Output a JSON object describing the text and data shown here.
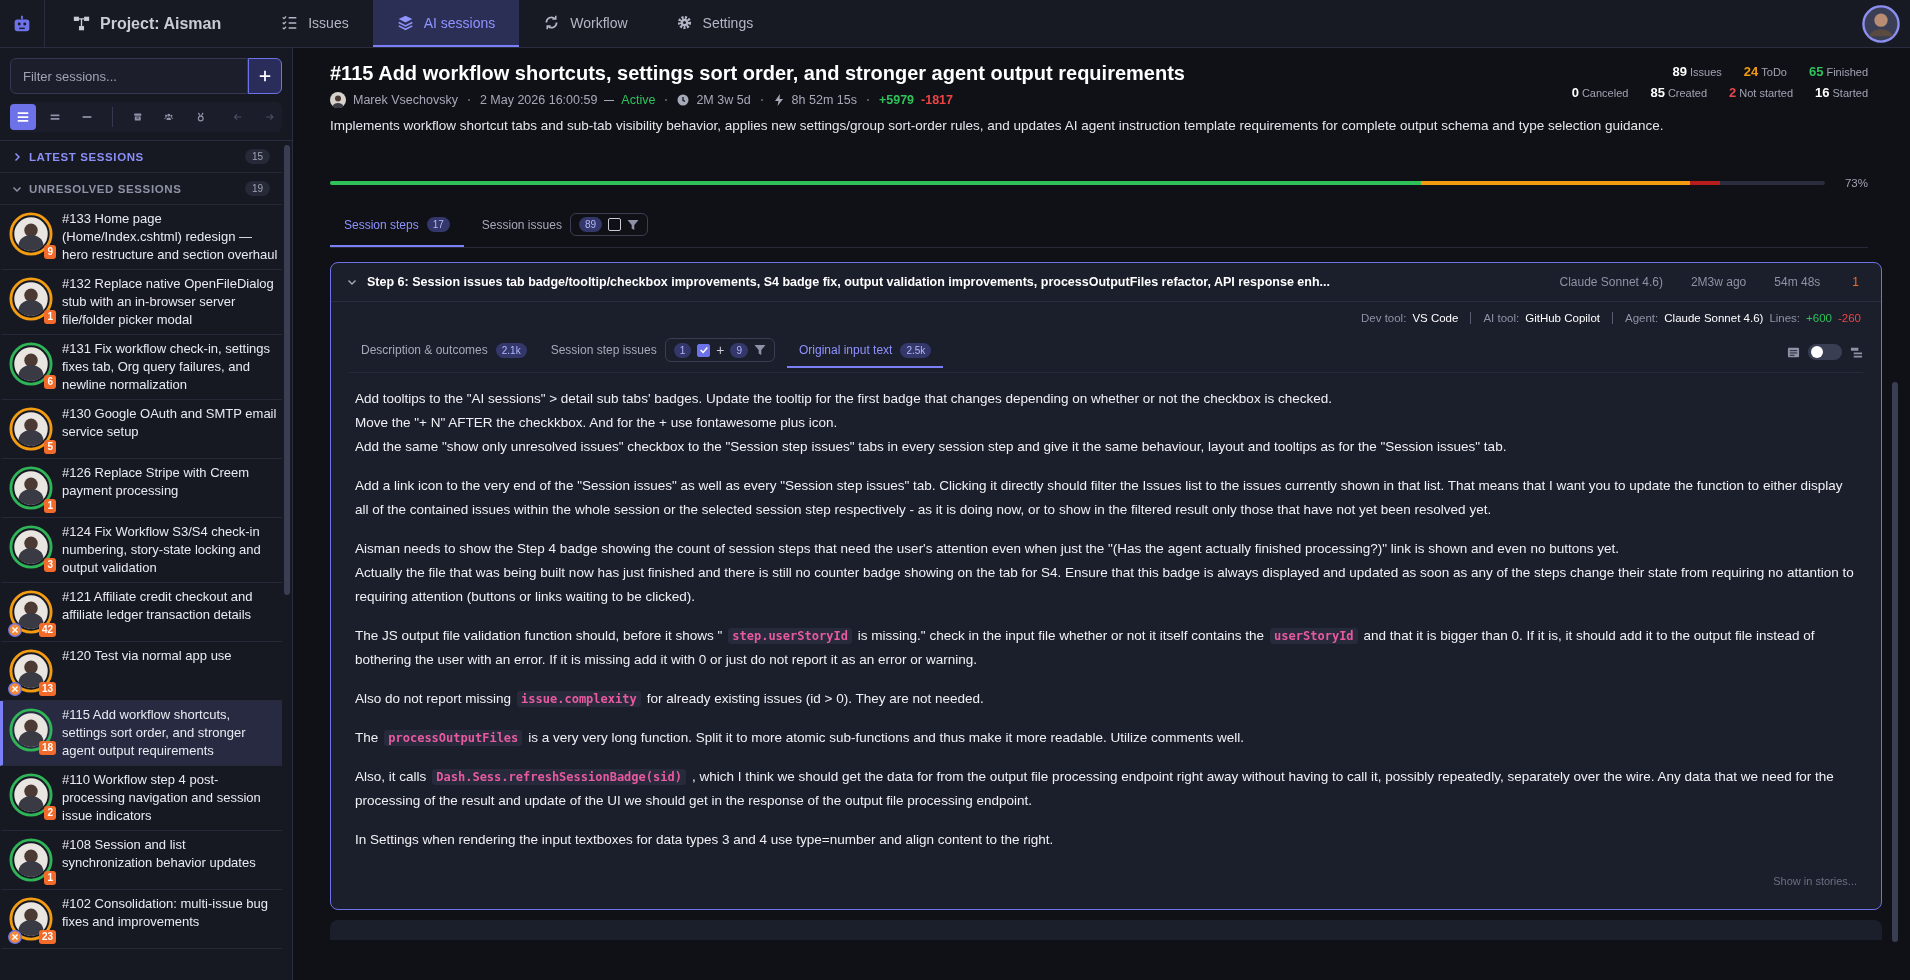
{
  "nav": {
    "project": "Project: Aisman",
    "tabs": [
      {
        "label": "Issues",
        "selected": false
      },
      {
        "label": "AI sessions",
        "selected": true
      },
      {
        "label": "Workflow",
        "selected": false
      },
      {
        "label": "Settings",
        "selected": false
      }
    ]
  },
  "sidebar": {
    "filter_placeholder": "Filter sessions...",
    "views": [
      {
        "selected": true
      },
      {
        "selected": false
      },
      {
        "selected": false
      }
    ],
    "sections": [
      {
        "title": "LATEST SESSIONS",
        "count": "15",
        "expanded": false
      },
      {
        "title": "UNRESOLVED SESSIONS",
        "count": "19",
        "expanded": true
      }
    ],
    "items": [
      {
        "title": "#133 Home page (Home/Index.cshtml) redesign — hero restructure and section overhaul",
        "badge": "9",
        "color": "#f39c12",
        "flagged": false,
        "selected": false
      },
      {
        "title": "#132 Replace native OpenFileDialog stub with an in-browser server file/folder picker modal",
        "badge": "1",
        "color": "#f39c12",
        "flagged": false,
        "selected": false
      },
      {
        "title": "#131 Fix workflow check-in, settings fixes tab, Org query failures, and newline normalization",
        "badge": "6",
        "color": "#2fb457",
        "flagged": false,
        "selected": false
      },
      {
        "title": "#130 Google OAuth and SMTP email service setup",
        "badge": "5",
        "color": "#f39c12",
        "flagged": false,
        "selected": false
      },
      {
        "title": "#126 Replace Stripe with Creem payment processing",
        "badge": "1",
        "color": "#2fb457",
        "flagged": false,
        "selected": false
      },
      {
        "title": "#124 Fix Workflow S3/S4 check-in numbering, story-state locking and output validation",
        "badge": "3",
        "color": "#2fb457",
        "flagged": false,
        "selected": false
      },
      {
        "title": "#121 Affiliate credit checkout and affiliate ledger transaction details",
        "badge": "42",
        "color": "#f39c12",
        "flagged": true,
        "selected": false
      },
      {
        "title": "#120 Test via normal app use",
        "badge": "13",
        "color": "#f39c12",
        "flagged": true,
        "selected": false
      },
      {
        "title": "#115 Add workflow shortcuts, settings sort order, and stronger agent output requirements",
        "badge": "18",
        "color": "#2fb457",
        "flagged": false,
        "selected": true
      },
      {
        "title": "#110 Workflow step 4 post-processing navigation and session issue indicators",
        "badge": "2",
        "color": "#2fb457",
        "flagged": false,
        "selected": false
      },
      {
        "title": "#108 Session and list synchronization behavior updates",
        "badge": "1",
        "color": "#2fb457",
        "flagged": false,
        "selected": false
      },
      {
        "title": "#102 Consolidation: multi-issue bug fixes and improvements",
        "badge": "23",
        "color": "#f39c12",
        "flagged": true,
        "selected": false
      }
    ]
  },
  "session": {
    "title": "#115 Add workflow shortcuts, settings sort order, and stronger agent output requirements",
    "author": "Marek Vsechovsky",
    "date": "2 May 2026 16:00:59",
    "status": "Active",
    "age": "2M 3w 5d",
    "duration": "8h 52m 15s",
    "added": "+5979",
    "removed": "-1817",
    "description": "Implements workflow shortcut tabs and sub-tab visibility behavior, applies new settings/group sort-order rules, and updates AI agent instruction template requirements for complete output schema and type selection guidance.",
    "stats": [
      [
        {
          "value": "89",
          "label": "Issues",
          "color": "#ffffff"
        },
        {
          "value": "24",
          "label": "ToDo",
          "color": "#f39c12"
        },
        {
          "value": "65",
          "label": "Finished",
          "color": "#2fc25b"
        }
      ],
      [
        {
          "value": "0",
          "label": "Canceled",
          "color": "#ffffff"
        },
        {
          "value": "85",
          "label": "Created",
          "color": "#ffffff"
        },
        {
          "value": "2",
          "label": "Not started",
          "color": "#e5484d"
        },
        {
          "value": "16",
          "label": "Started",
          "color": "#ffffff"
        }
      ]
    ],
    "progress": {
      "segments": [
        {
          "level": 0.73,
          "color": "#2fc25b"
        },
        {
          "level": 0.91,
          "color": "#f39c12"
        },
        {
          "level": 0.93,
          "color": "#b91c1c"
        }
      ],
      "label": "73%"
    }
  },
  "tabs": [
    {
      "kind": "plain",
      "label": "Session steps",
      "badge": "17",
      "selected": true
    },
    {
      "kind": "filter",
      "label": "Session issues",
      "badge": "89",
      "checked": false,
      "selected": false
    }
  ],
  "step": {
    "expanded": true,
    "title": "Step 6: Session issues tab badge/tooltip/checkbox improvements, S4 badge fix, output validation improvements, processOutputFiles refactor, API response enh...",
    "model": "Claude Sonnet 4.6)",
    "ago": "2M3w ago",
    "duration": "54m 48s",
    "count": "1",
    "meta": {
      "dev_tool_label": "Dev tool:",
      "dev_tool": "VS Code",
      "ai_tool_label": "AI tool:",
      "ai_tool": "GitHub Copilot",
      "agent_label": "Agent:",
      "agent": "Claude Sonnet 4.6)",
      "lines_label": "Lines:",
      "added": "+600",
      "removed": "-260"
    },
    "subtabs": [
      {
        "kind": "plain",
        "label": "Description & outcomes",
        "badge": "2.1k",
        "selected": false
      },
      {
        "kind": "issues",
        "label": "Session step issues",
        "badge": "1",
        "checked": true,
        "plus": "+",
        "extra": "9",
        "selected": false
      },
      {
        "kind": "plain",
        "label": "Original input text",
        "badge": "2.5k",
        "selected": true
      }
    ],
    "toggle": {
      "on": false
    },
    "paragraphs": [
      [
        [
          {
            "kind": "text",
            "text": "Add tooltips to the \"AI sessions\" > detail sub tabs' badges. Update the tooltip for the first badge that changes depending on whether or not the checkbox is checked."
          }
        ],
        [
          {
            "kind": "text",
            "text": "Move the \"+ N\" AFTER the checkkbox. And for the + use fontawesome plus icon."
          }
        ],
        [
          {
            "kind": "text",
            "text": "Add the same \"show only unresolved issues\" checkbox to the \"Session step issues\" tabs in every session step and give it the same behaviour, layout and tooltips as for the \"Session issues\" tab."
          }
        ]
      ],
      [
        [
          {
            "kind": "text",
            "text": "Add a link icon to the very end of the \"Session issues\" as well as every \"Session step issues\" tab. Clicking it directly should filter the Issues list to the issues currently shown in that list. That means that I want you to update the function to either display all of the contained issues within the whole session or the selected session step respectively - as it is doing now, or to show in the filtered result only those that have not yet been resolved yet."
          }
        ]
      ],
      [
        [
          {
            "kind": "text",
            "text": "Aisman needs to show the Step 4 badge showing the count of session steps that need the user's attention even when just the \"(Has the agent actually finished processing?)\" link is shown and even no buttons yet."
          }
        ],
        [
          {
            "kind": "text",
            "text": "Actually the file that was being built now has just finished and there is still no counter badge showing on the tab for S4. Ensure that this badge is always displayed and updated as soon as any of the steps change their state from requiring no attantion to requiring attention (buttons or links waiting to be clicked)."
          }
        ]
      ],
      [
        [
          {
            "kind": "text",
            "text": "The JS output file validation function should, before it shows \""
          },
          {
            "kind": "code",
            "text": "step.userStoryId"
          },
          {
            "kind": "text",
            "text": "is missing.\" check in the input file whether or not it itself contains the"
          },
          {
            "kind": "code",
            "text": "userStoryId"
          },
          {
            "kind": "text",
            "text": "and that it is bigger than 0. If it is, it should add it to the output file instead of bothering the user with an error. If it is missing add it with 0 or just do not report it as an error or warning."
          }
        ]
      ],
      [
        [
          {
            "kind": "text",
            "text": "Also do not report missing"
          },
          {
            "kind": "code",
            "text": "issue.complexity"
          },
          {
            "kind": "text",
            "text": "for already existing issues (id > 0). They are not needed."
          }
        ]
      ],
      [
        [
          {
            "kind": "text",
            "text": "The"
          },
          {
            "kind": "code",
            "text": "processOutputFiles"
          },
          {
            "kind": "text",
            "text": "is a very very long function. Split it to more atomic sub-functions and thus make it more readable. Utilize comments well."
          }
        ]
      ],
      [
        [
          {
            "kind": "text",
            "text": "Also, it calls"
          },
          {
            "kind": "code",
            "text": "Dash.Sess.refreshSessionBadge(sid)"
          },
          {
            "kind": "text",
            "text": ", which I think we should get the data for from the output file processing endpoint right away without having to call it, possibly repeatedly, separately over the wire. Any data that we need for the processing of the result and update of the UI we should get in the response of the output file processing endpoint."
          }
        ]
      ],
      [
        [
          {
            "kind": "text",
            "text": "In Settings when rendering the input textboxes for data types 3 and 4 use type=number and align content to the right."
          }
        ]
      ]
    ],
    "footer_link": "Show in stories..."
  }
}
